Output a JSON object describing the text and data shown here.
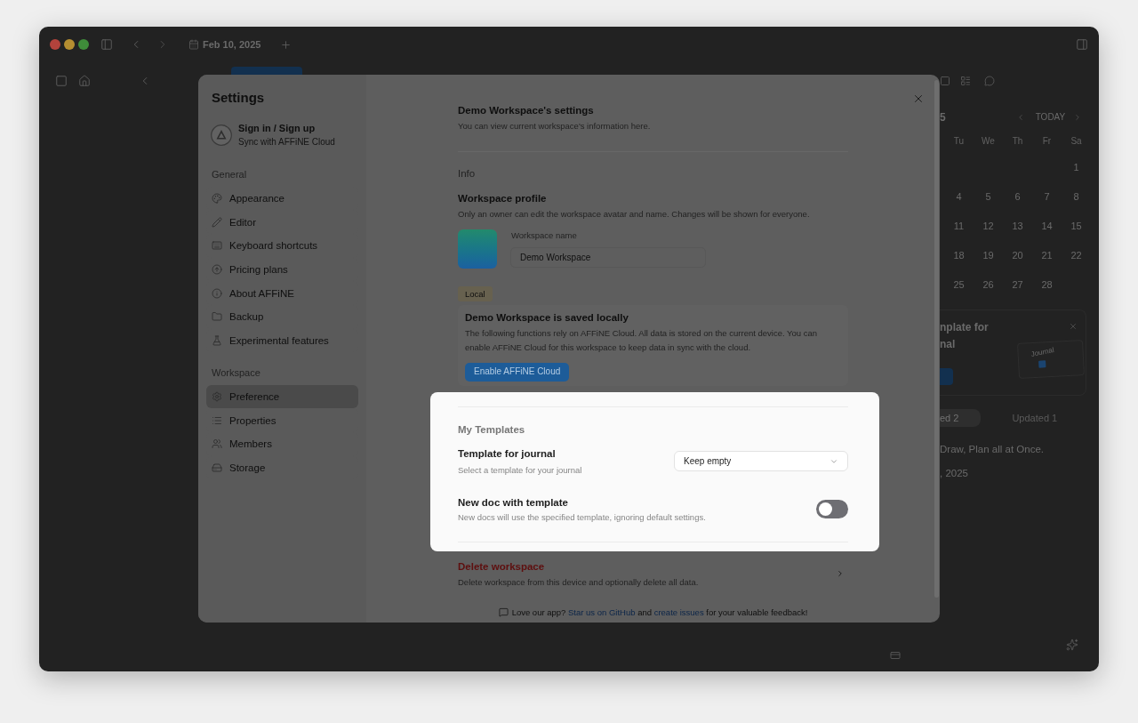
{
  "app_window": {
    "title_bar": {
      "date": "Feb 10, 2025"
    },
    "calendar": {
      "month_fragment": "5",
      "today_button": "TODAY",
      "weekdays": [
        "Tu",
        "We",
        "Th",
        "Fr",
        "Sa"
      ],
      "weeks": [
        [
          "1"
        ],
        [
          "4",
          "5",
          "6",
          "7",
          "8"
        ],
        [
          "11",
          "12",
          "13",
          "14",
          "15"
        ],
        [
          "18",
          "19",
          "20",
          "21",
          "22"
        ],
        [
          "25",
          "26",
          "27",
          "28"
        ]
      ]
    },
    "template_card": {
      "title_lines": [
        "nplate for",
        "nal"
      ],
      "preview_label": "Journal"
    },
    "doc_tabs": [
      {
        "label": "ed 2",
        "selected": true
      },
      {
        "label": "Updated 1",
        "selected": false
      }
    ],
    "doc_item": {
      "title": "Draw, Plan all at Once.",
      "date": ", 2025"
    }
  },
  "settings": {
    "title": "Settings",
    "account": {
      "name": "Sign in / Sign up",
      "subtitle": "Sync with AFFiNE Cloud"
    },
    "groups": [
      {
        "heading": "General",
        "items": [
          {
            "label": "Appearance",
            "selected": false
          },
          {
            "label": "Editor",
            "selected": false
          },
          {
            "label": "Keyboard shortcuts",
            "selected": false
          },
          {
            "label": "Pricing plans",
            "selected": false
          },
          {
            "label": "About AFFiNE",
            "selected": false
          },
          {
            "label": "Backup",
            "selected": false
          },
          {
            "label": "Experimental features",
            "selected": false
          }
        ]
      },
      {
        "heading": "Workspace",
        "items": [
          {
            "label": "Preference",
            "selected": true
          },
          {
            "label": "Properties",
            "selected": false
          },
          {
            "label": "Members",
            "selected": false
          },
          {
            "label": "Storage",
            "selected": false
          }
        ]
      }
    ],
    "workspace": {
      "title": "Demo Workspace's settings",
      "subtitle": "You can view current workspace's information here.",
      "info": {
        "heading": "Info",
        "profile_title": "Workspace profile",
        "profile_description": "Only an owner can edit the workspace avatar and name. Changes will be shown for everyone.",
        "name_label": "Workspace name",
        "name_value": "Demo Workspace"
      },
      "storage": {
        "badge": "Local",
        "title": "Demo Workspace is saved locally",
        "description": "The following functions rely on AFFiNE Cloud. All data is stored on the current device. You can enable AFFiNE Cloud for this workspace to keep data in sync with the cloud.",
        "button": "Enable AFFiNE Cloud"
      },
      "templates": {
        "highlighted": true,
        "heading": "My Templates",
        "rows": [
          {
            "kind": "select",
            "title": "Template for journal",
            "description": "Select a template for your journal",
            "value": "Keep empty"
          },
          {
            "kind": "switch",
            "title": "New doc with template",
            "description": "New docs will use the specified template, ignoring default settings.",
            "on": false
          }
        ]
      },
      "danger": {
        "title": "Delete workspace",
        "description": "Delete workspace from this device and optionally delete all data."
      },
      "feedback": [
        {
          "kind": "text",
          "text": "Love our app?"
        },
        {
          "kind": "link",
          "text": "Star us on GitHub"
        },
        {
          "kind": "text",
          "text": "and"
        },
        {
          "kind": "link",
          "text": "create issues"
        },
        {
          "kind": "text",
          "text": "for your valuable feedback!"
        }
      ]
    }
  }
}
